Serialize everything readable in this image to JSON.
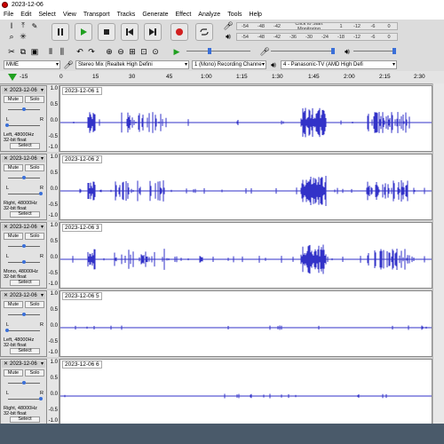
{
  "window": {
    "title": "2023-12-06"
  },
  "menu": [
    "File",
    "Edit",
    "Select",
    "View",
    "Transport",
    "Tracks",
    "Generate",
    "Effect",
    "Analyze",
    "Tools",
    "Help"
  ],
  "meters": {
    "record_ticks": [
      "-54",
      "-48",
      "-42",
      "Click to Start Monitoring",
      "1",
      "-12",
      "-6",
      "0"
    ],
    "play_ticks": [
      "-54",
      "-48",
      "-42",
      "-36",
      "-30",
      "-24",
      "-18",
      "-12",
      "-6",
      "0"
    ]
  },
  "devices": {
    "host": "MME",
    "input": "Stereo Mix (Realtek High Defini",
    "channels": "1 (Mono) Recording Channe",
    "output": "4 - Panasonic-TV (AMD High Defi"
  },
  "ruler": {
    "ticks": [
      "-15",
      "0",
      "15",
      "30",
      "45",
      "1:00",
      "1:15",
      "1:30",
      "1:45",
      "2:00",
      "2:15",
      "2:30"
    ]
  },
  "tracks": [
    {
      "name": "2023-12-06",
      "label": "2023-12-06 1",
      "info1": "Left, 48000Hz",
      "info2": "32-bit float"
    },
    {
      "name": "2023-12-06",
      "label": "2023-12-06 2",
      "info1": "Right, 48000Hz",
      "info2": "32-bit float"
    },
    {
      "name": "2023-12-06",
      "label": "2023-12-06 3",
      "info1": "Mono, 48000Hz",
      "info2": "32-bit float"
    },
    {
      "name": "2023-12-06",
      "label": "2023-12-06 5",
      "info1": "Left, 48000Hz",
      "info2": "32-bit float"
    },
    {
      "name": "2023-12-06",
      "label": "2023-12-06 6",
      "info1": "Right, 48000Hz",
      "info2": "32-bit float"
    }
  ],
  "track_ui": {
    "mute": "Mute",
    "solo": "Solo",
    "select": "Select",
    "l": "L",
    "r": "R",
    "y_top": "1.0",
    "y_mid": "0.0",
    "y_bot": "-1.0",
    "y_up": "0.5",
    "y_low": "-0.5"
  },
  "colors": {
    "wave": "#3232c8",
    "wave_bg": "#ffffff",
    "record": "#d22020",
    "play": "#20a020"
  },
  "icons": {
    "pause": "pause-icon",
    "play": "play-icon",
    "stop": "stop-icon",
    "skip_start": "skip-start-icon",
    "skip_end": "skip-end-icon",
    "record": "record-icon",
    "loop": "loop-icon"
  }
}
